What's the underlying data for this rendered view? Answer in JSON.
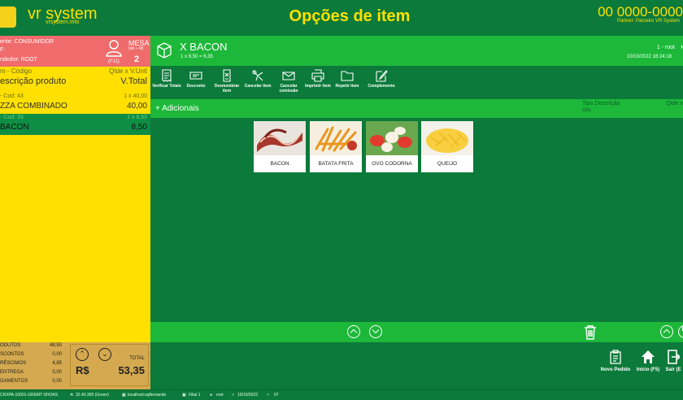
{
  "app": {
    "logo_text": "vr system",
    "logo_url": "vrsystem.info",
    "title": "Opções de item",
    "phone": "00 0000-0000",
    "partner": "Partner: Parceiro VR System"
  },
  "order": {
    "client": "ente: CONSUMIDOR",
    "client2": "F:",
    "seller": "ndedor: ROOT",
    "f11": "(F11)",
    "mesa_label": "MESA",
    "mesa_shortcut": "(alt + M)",
    "mesa_number": "2",
    "col_code": "m - Código",
    "col_qty": "Qtde x V.Unit",
    "col_desc": "escrição produto",
    "col_total": "V.Total",
    "items": [
      {
        "code": "- Cod: 43",
        "qty": "1 x 40,00",
        "name": "ZZA COMBINADO",
        "total": "40,00"
      },
      {
        "code": "- Cod: 33",
        "qty": "1 x 8,50",
        "name": "BACON",
        "total": "8,50"
      }
    ]
  },
  "totals": {
    "rows": [
      {
        "label": "ODUTOS",
        "value": "48,50"
      },
      {
        "label": "SCONTOS",
        "value": "0,00"
      },
      {
        "label": "RÉSCIMOS",
        "value": "4,85"
      },
      {
        "label": "ENTREGA",
        "value": "0,00"
      },
      {
        "label": "GAMENTOS",
        "value": "0,00"
      }
    ],
    "currency": "R$",
    "total_label": "TOTAL",
    "total_value": "53,35"
  },
  "product": {
    "name": "X BACON",
    "detail": "1 x 8,50 = 9,35",
    "user": "1 - root",
    "datetime": "10/10/2022 16:24:18"
  },
  "toolbar": [
    {
      "label": "Verificar Totais",
      "icon": "receipt-icon"
    },
    {
      "label": "Desconto",
      "icon": "ticket-icon"
    },
    {
      "label": "Desmembrar item",
      "icon": "split-icon"
    },
    {
      "label": "Cancelar item",
      "icon": "cancel-item-icon"
    },
    {
      "label": "Cancelar comissão",
      "icon": "envelope-icon"
    },
    {
      "label": "Imprimir item",
      "icon": "printer-icon"
    },
    {
      "label": "Repetir item",
      "icon": "folder-icon"
    },
    {
      "label": "Complemento",
      "icon": "edit-icon"
    }
  ],
  "additionals": {
    "label": "+ Adicionais",
    "header_type": "Tipo",
    "header_desc": "Descrição",
    "header_sub": "Obs",
    "header_qty": "Qtde x",
    "items": [
      {
        "label": "BACON",
        "color": "#b5473a"
      },
      {
        "label": "BATATA FRITA",
        "color": "#f0a020"
      },
      {
        "label": "OVO CODORNA",
        "color": "#e84a3a"
      },
      {
        "label": "QUEIJO",
        "color": "#f8d24a"
      }
    ]
  },
  "actions": [
    {
      "label": "Novo Pedido",
      "icon": "clipboard-icon"
    },
    {
      "label": "Início (F5)",
      "icon": "home-icon"
    },
    {
      "label": "Sair (E",
      "icon": "exit-icon"
    }
  ],
  "status": {
    "pc": "CRXPA-10001-GREMT-SHOAS",
    "version": "32.40.300 (Green)",
    "host": "localhost:sqlfernando",
    "branch": "Filial 1",
    "user": "root",
    "date": "10/10/2022",
    "num": "97"
  },
  "colors": {
    "yellow": "#ffe000",
    "green": "#0b7a3a",
    "light_green": "#1db83a",
    "red": "#f06b6b"
  }
}
